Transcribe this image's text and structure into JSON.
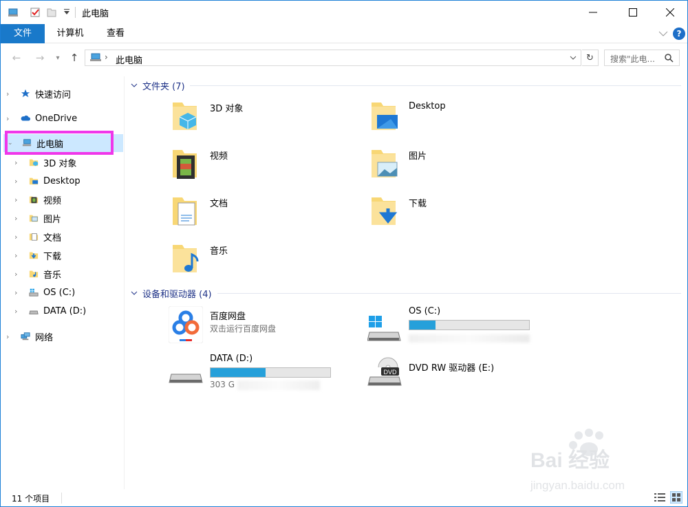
{
  "window": {
    "title": "此电脑"
  },
  "ribbon": {
    "tabs": [
      "文件",
      "计算机",
      "查看"
    ]
  },
  "address": {
    "path": "此电脑",
    "search_placeholder": "搜索\"此电..."
  },
  "sidebar": {
    "quick_access": "快速访问",
    "onedrive": "OneDrive",
    "this_pc": "此电脑",
    "children": [
      "3D 对象",
      "Desktop",
      "视频",
      "图片",
      "文档",
      "下载",
      "音乐",
      "OS (C:)",
      "DATA (D:)"
    ],
    "network": "网络"
  },
  "folders": {
    "header": "文件夹 (7)",
    "items": [
      "3D 对象",
      "Desktop",
      "视频",
      "图片",
      "文档",
      "下载",
      "音乐"
    ]
  },
  "devices": {
    "header": "设备和驱动器 (4)",
    "baidu": {
      "name": "百度网盘",
      "sub": "双击运行百度网盘"
    },
    "os": {
      "name": "OS (C:)",
      "used_fraction": 0.22
    },
    "data": {
      "name": "DATA (D:)",
      "used_fraction": 0.46,
      "free_text": "303 G"
    },
    "dvd": {
      "name": "DVD RW 驱动器 (E:)",
      "label": "DVD"
    }
  },
  "status": {
    "item_count": "11 个项目"
  },
  "watermark": {
    "brand": "Bai  经验",
    "url": "jingyan.baidu.com"
  },
  "colors": {
    "accent": "#1979ca",
    "bar_fill": "#26a0da",
    "folder": "#f8d775",
    "highlight": "#ef37ea"
  }
}
